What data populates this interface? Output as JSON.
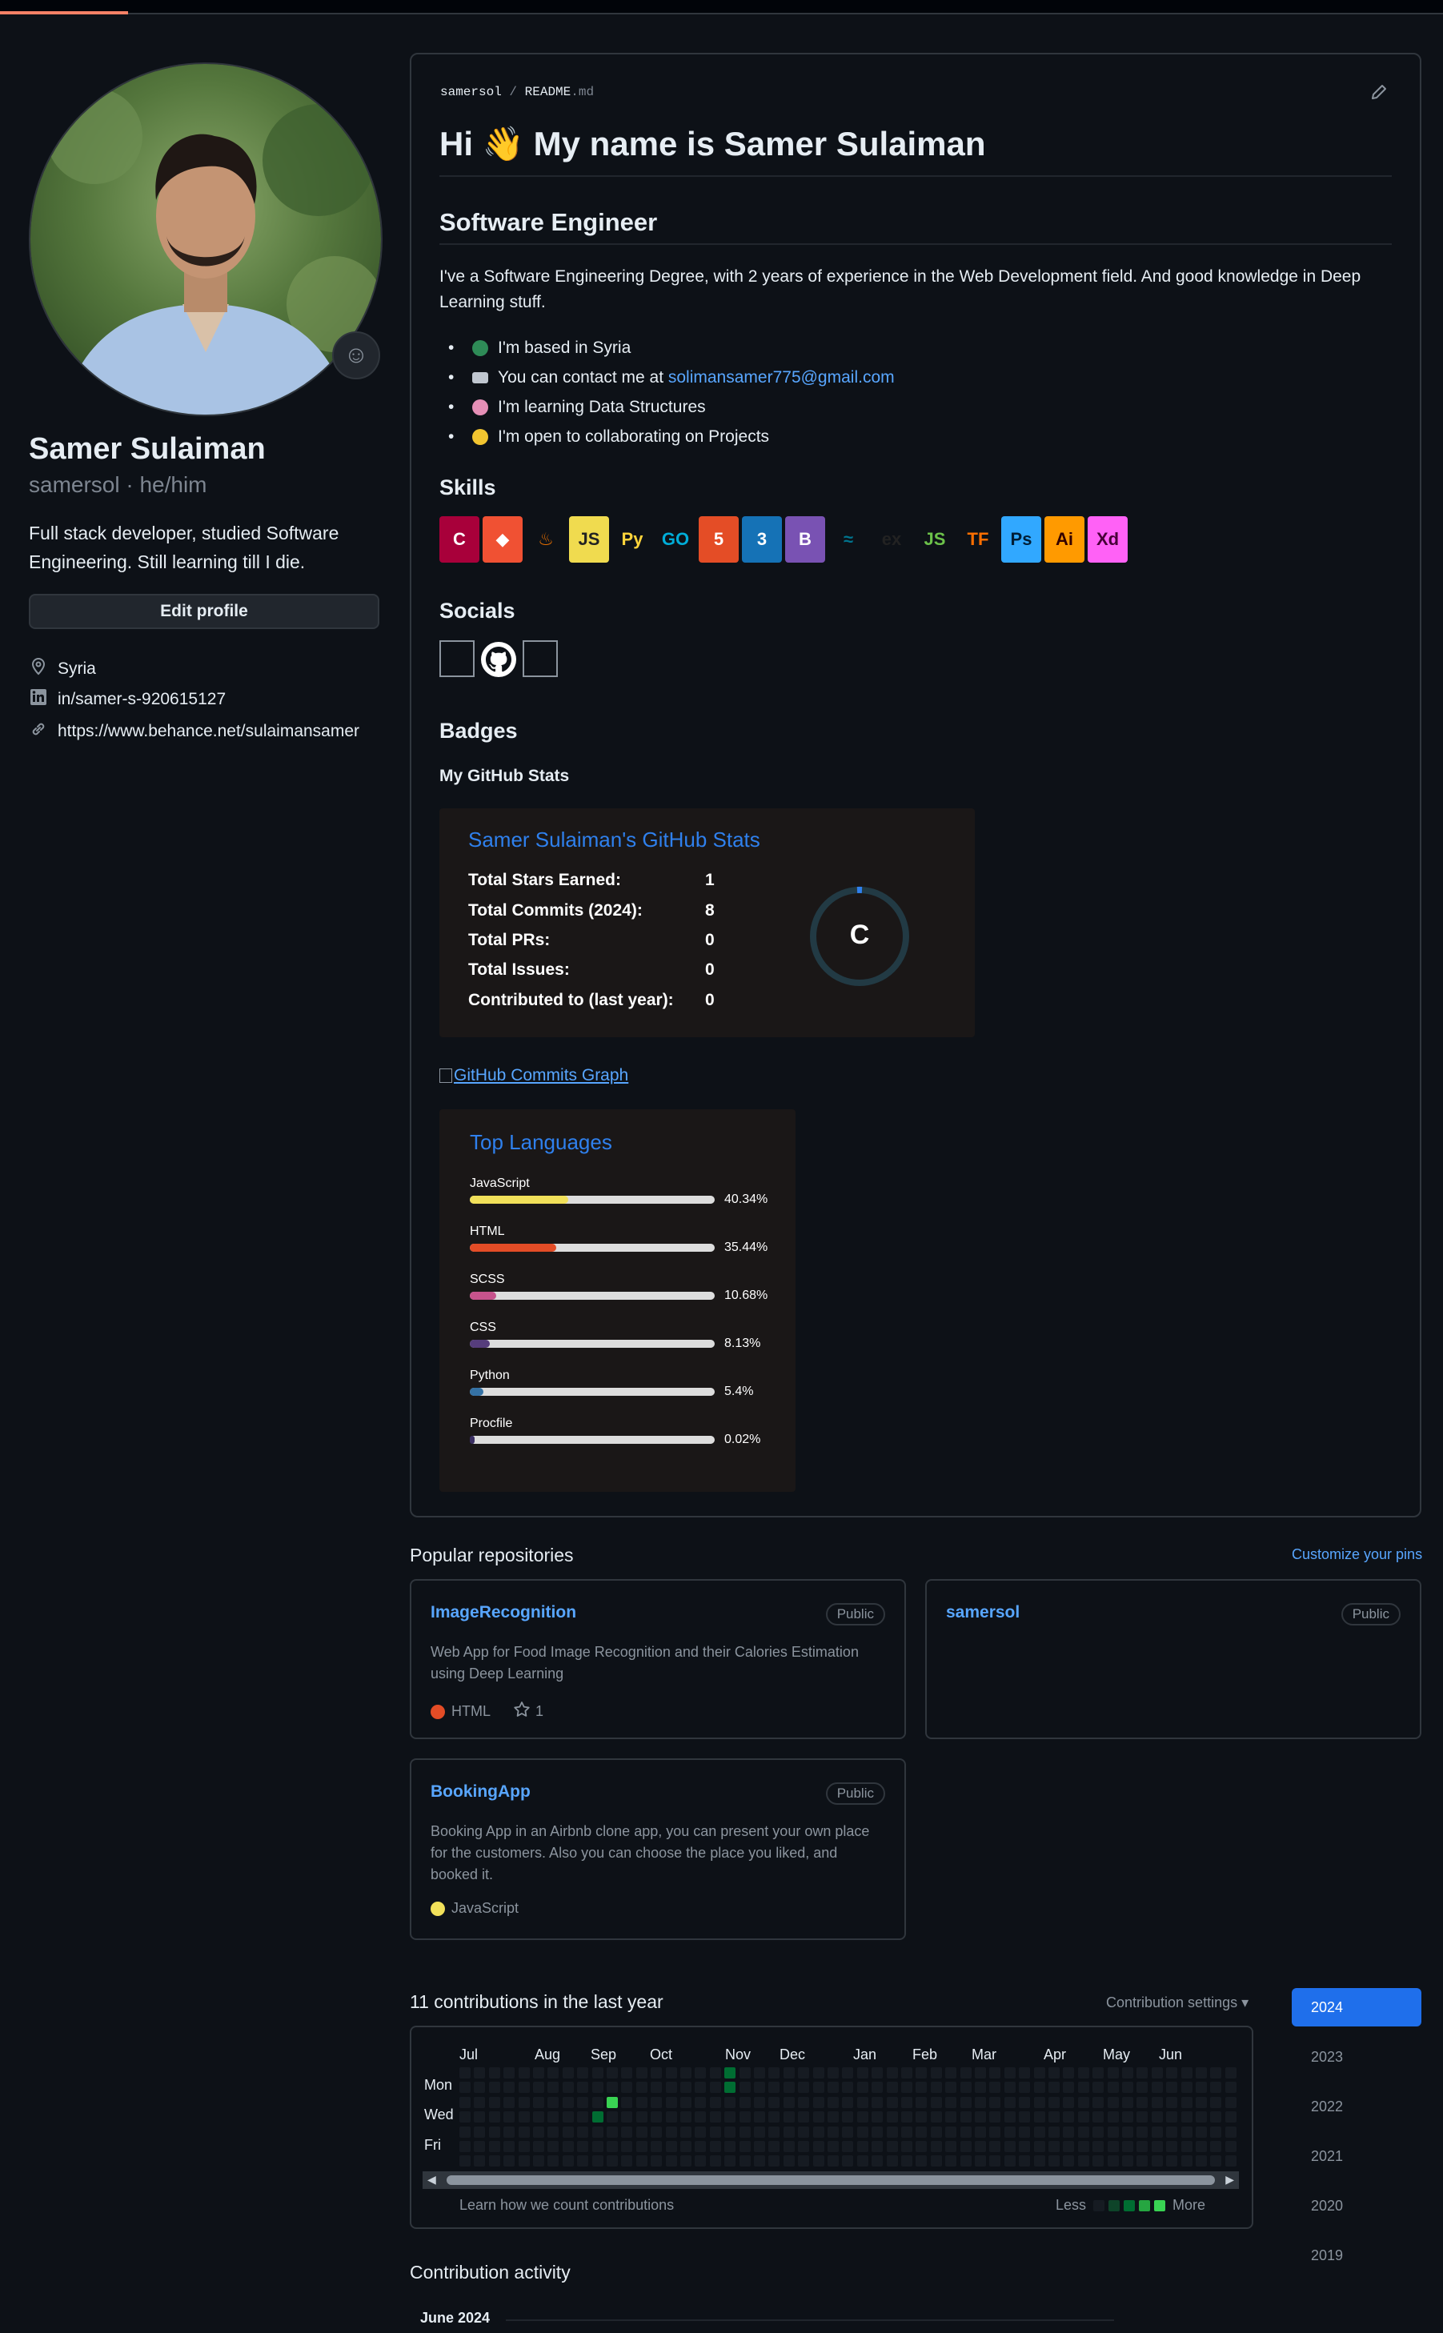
{
  "profile": {
    "name": "Samer Sulaiman",
    "handle": "samersol · he/him",
    "bio": "Full stack developer, studied Software Engineering. Still learning till I die.",
    "edit_label": "Edit profile",
    "location": "Syria",
    "linkedin": "in/samer-s-920615127",
    "website": "https://www.behance.net/sulaimansamer"
  },
  "readme": {
    "path_owner": "samersol",
    "path_sep": "/",
    "path_file": "README",
    "path_ext": ".md",
    "title": "Hi 👋 My name is Samer Sulaiman",
    "role": "Software Engineer",
    "intro": "I've a Software Engineering Degree, with 2 years of experience in the Web Development field. And good knowledge in Deep Learning stuff.",
    "bullets": [
      {
        "text": "I'm based in Syria",
        "color": "#2e8b57"
      },
      {
        "text_before": "You can contact me at ",
        "email": "solimansamer775@gmail.com",
        "color": "#c0c7d0"
      },
      {
        "text": "I'm learning Data Structures",
        "color": "#e58fb6"
      },
      {
        "text": "I'm open to collaborating on Projects",
        "color": "#f2c530"
      }
    ],
    "skills_heading": "Skills",
    "skills": [
      {
        "icon": "c-icon",
        "label": "C",
        "bg": "#a8003a",
        "fg": "#ffffff"
      },
      {
        "icon": "git-icon",
        "label": "◆",
        "bg": "#f05133",
        "fg": "#ffffff"
      },
      {
        "icon": "java-icon",
        "label": "♨",
        "bg": "transparent",
        "fg": "#e76f00"
      },
      {
        "icon": "javascript-icon",
        "label": "JS",
        "bg": "#f0db4f",
        "fg": "#222222"
      },
      {
        "icon": "python-icon",
        "label": "Py",
        "bg": "transparent",
        "fg": "#ffd43b"
      },
      {
        "icon": "go-icon",
        "label": "GO",
        "bg": "transparent",
        "fg": "#00add8"
      },
      {
        "icon": "html5-icon",
        "label": "5",
        "bg": "#e44d26",
        "fg": "#ffffff"
      },
      {
        "icon": "css3-icon",
        "label": "3",
        "bg": "#1572b6",
        "fg": "#ffffff"
      },
      {
        "icon": "bootstrap-icon",
        "label": "B",
        "bg": "#7952b3",
        "fg": "#ffffff"
      },
      {
        "icon": "mysql-icon",
        "label": "≈",
        "bg": "transparent",
        "fg": "#00758f"
      },
      {
        "icon": "express-icon",
        "label": "ex",
        "bg": "transparent",
        "fg": "#222222"
      },
      {
        "icon": "nodejs-icon",
        "label": "JS",
        "bg": "transparent",
        "fg": "#6cc24a"
      },
      {
        "icon": "tensorflow-icon",
        "label": "TF",
        "bg": "transparent",
        "fg": "#ff6f00"
      },
      {
        "icon": "photoshop-icon",
        "label": "Ps",
        "bg": "#31a8ff",
        "fg": "#001e36"
      },
      {
        "icon": "illustrator-icon",
        "label": "Ai",
        "bg": "#ff9a00",
        "fg": "#330000"
      },
      {
        "icon": "xd-icon",
        "label": "Xd",
        "bg": "#ff61f6",
        "fg": "#470137"
      }
    ],
    "socials_heading": "Socials",
    "badges_heading": "Badges",
    "github_stats_heading": "My GitHub Stats",
    "commits_graph_alt": "GitHub Commits Graph"
  },
  "stats_card": {
    "title": "Samer Sulaiman's GitHub Stats",
    "rank": "C",
    "rows": [
      {
        "label": "Total Stars Earned:",
        "value": "1"
      },
      {
        "label": "Total Commits (2024):",
        "value": "8"
      },
      {
        "label": "Total PRs:",
        "value": "0"
      },
      {
        "label": "Total Issues:",
        "value": "0"
      },
      {
        "label": "Contributed to (last year):",
        "value": "0"
      }
    ]
  },
  "languages_card": {
    "title": "Top Languages",
    "items": [
      {
        "name": "JavaScript",
        "percent_label": "40.34%",
        "percent": 40.34,
        "color": "#f1e05a"
      },
      {
        "name": "HTML",
        "percent_label": "35.44%",
        "percent": 35.44,
        "color": "#e34c26"
      },
      {
        "name": "SCSS",
        "percent_label": "10.68%",
        "percent": 10.68,
        "color": "#c6538c"
      },
      {
        "name": "CSS",
        "percent_label": "8.13%",
        "percent": 8.13,
        "color": "#563d7c"
      },
      {
        "name": "Python",
        "percent_label": "5.4%",
        "percent": 5.4,
        "color": "#3572a5"
      },
      {
        "name": "Procfile",
        "percent_label": "0.02%",
        "percent": 0.02,
        "color": "#3b2f63"
      }
    ]
  },
  "repos": {
    "heading": "Popular repositories",
    "customize": "Customize your pins",
    "items": [
      {
        "name": "ImageRecognition",
        "visibility": "Public",
        "desc": "Web App for Food Image Recognition and their Calories Estimation using Deep Learning",
        "lang": "HTML",
        "lang_color": "#e34c26",
        "stars": "1"
      },
      {
        "name": "samersol",
        "visibility": "Public"
      },
      {
        "name": "BookingApp",
        "visibility": "Public",
        "desc": "Booking App in an Airbnb clone app, you can present your own place for the customers. Also you can choose the place you liked, and booked it.",
        "lang": "JavaScript",
        "lang_color": "#f1e05a"
      }
    ]
  },
  "contributions": {
    "heading": "11 contributions in the last year",
    "settings": "Contribution settings ▾",
    "months": [
      "Jul",
      "Aug",
      "Sep",
      "Oct",
      "Nov",
      "Dec",
      "Jan",
      "Feb",
      "Mar",
      "Apr",
      "May",
      "Jun"
    ],
    "days": [
      "Mon",
      "Wed",
      "Fri"
    ],
    "learn": "Learn how we count contributions",
    "less": "Less",
    "more": "More",
    "levels": [
      "#161b22",
      "#0e4429",
      "#006d32",
      "#26a641",
      "#39d353"
    ],
    "active_cells": [
      {
        "week": 18,
        "day": 0,
        "level": 2
      },
      {
        "week": 18,
        "day": 1,
        "level": 2
      },
      {
        "week": 10,
        "day": 2,
        "level": 4
      },
      {
        "week": 9,
        "day": 3,
        "level": 2
      }
    ],
    "years": [
      "2024",
      "2023",
      "2022",
      "2021",
      "2020",
      "2019"
    ],
    "active_year": "2024",
    "activity_heading": "Contribution activity",
    "activity_month": "June 2024"
  }
}
